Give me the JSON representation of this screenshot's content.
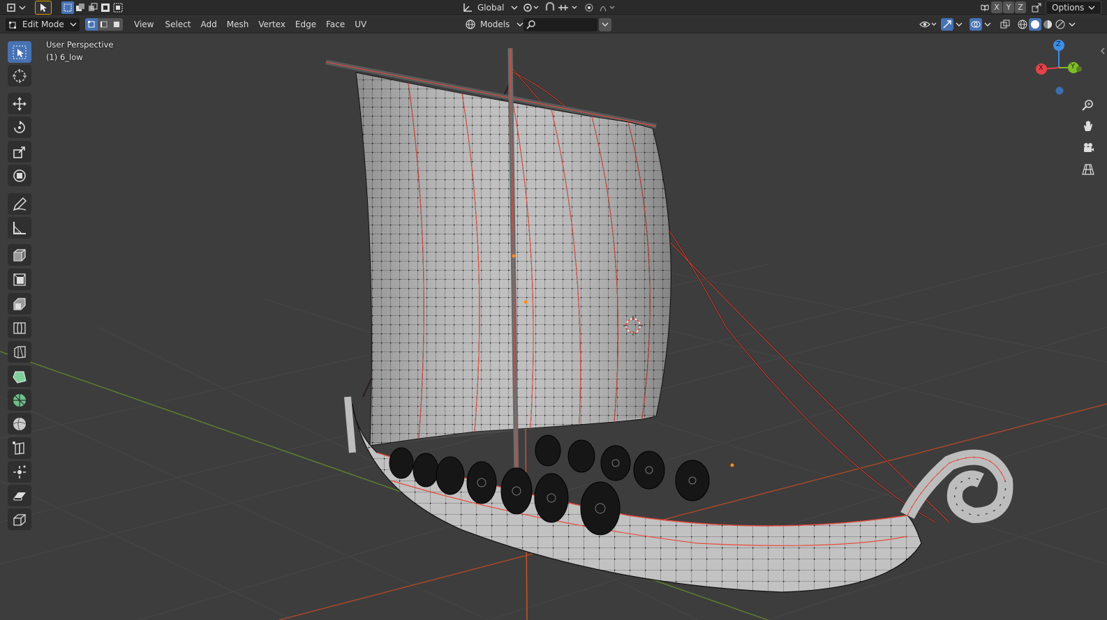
{
  "topbar": {
    "transform_orientation": "Global",
    "axis_x": "X",
    "axis_y": "Y",
    "axis_z": "Z",
    "options_label": "Options"
  },
  "header": {
    "mode": "Edit Mode",
    "menus": [
      "View",
      "Select",
      "Add",
      "Mesh",
      "Vertex",
      "Edge",
      "Face",
      "UV"
    ],
    "collection": "Models",
    "search_value": ""
  },
  "viewport": {
    "perspective_label": "User Perspective",
    "object_label": "(1) 6_low",
    "gizmo": {
      "x": "X",
      "y": "Y",
      "z": "Z"
    }
  },
  "tools": [
    "select-box-tool",
    "cursor-tool",
    "move-tool",
    "rotate-tool",
    "scale-tool",
    "transform-tool",
    "annotate-tool",
    "measure-tool",
    "add-cube-tool",
    "extrude-tool",
    "inset-tool",
    "bevel-tool",
    "loop-cut-tool",
    "knife-tool",
    "poly-build-tool",
    "spin-tool",
    "smooth-tool",
    "edge-slide-tool",
    "shrink-fatten-tool",
    "shear-tool",
    "rip-region-tool"
  ],
  "colors": {
    "accent": "#4772b3",
    "axis_x": "#e4434b",
    "axis_y": "#7fbd26",
    "axis_z": "#3d8ee8",
    "selected_edge": "#e84a3c",
    "mesh_surface": "#b9b9b9"
  }
}
